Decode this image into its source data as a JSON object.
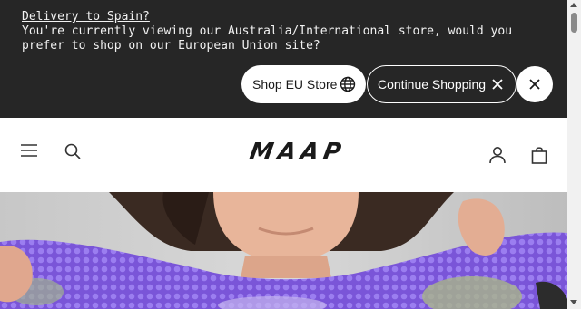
{
  "banner": {
    "title": "Delivery to Spain?",
    "message": "You're currently viewing our Australia/International store, would you prefer to shop on our European Union site?",
    "shop_eu_label": "Shop EU Store",
    "continue_label": "Continue Shopping",
    "background": "#262626"
  },
  "header": {
    "logo_text": "MAAP",
    "icons": [
      "menu-icon",
      "search-icon",
      "account-icon",
      "bag-icon"
    ]
  },
  "hero": {
    "primary_color": "#7a55d8"
  }
}
